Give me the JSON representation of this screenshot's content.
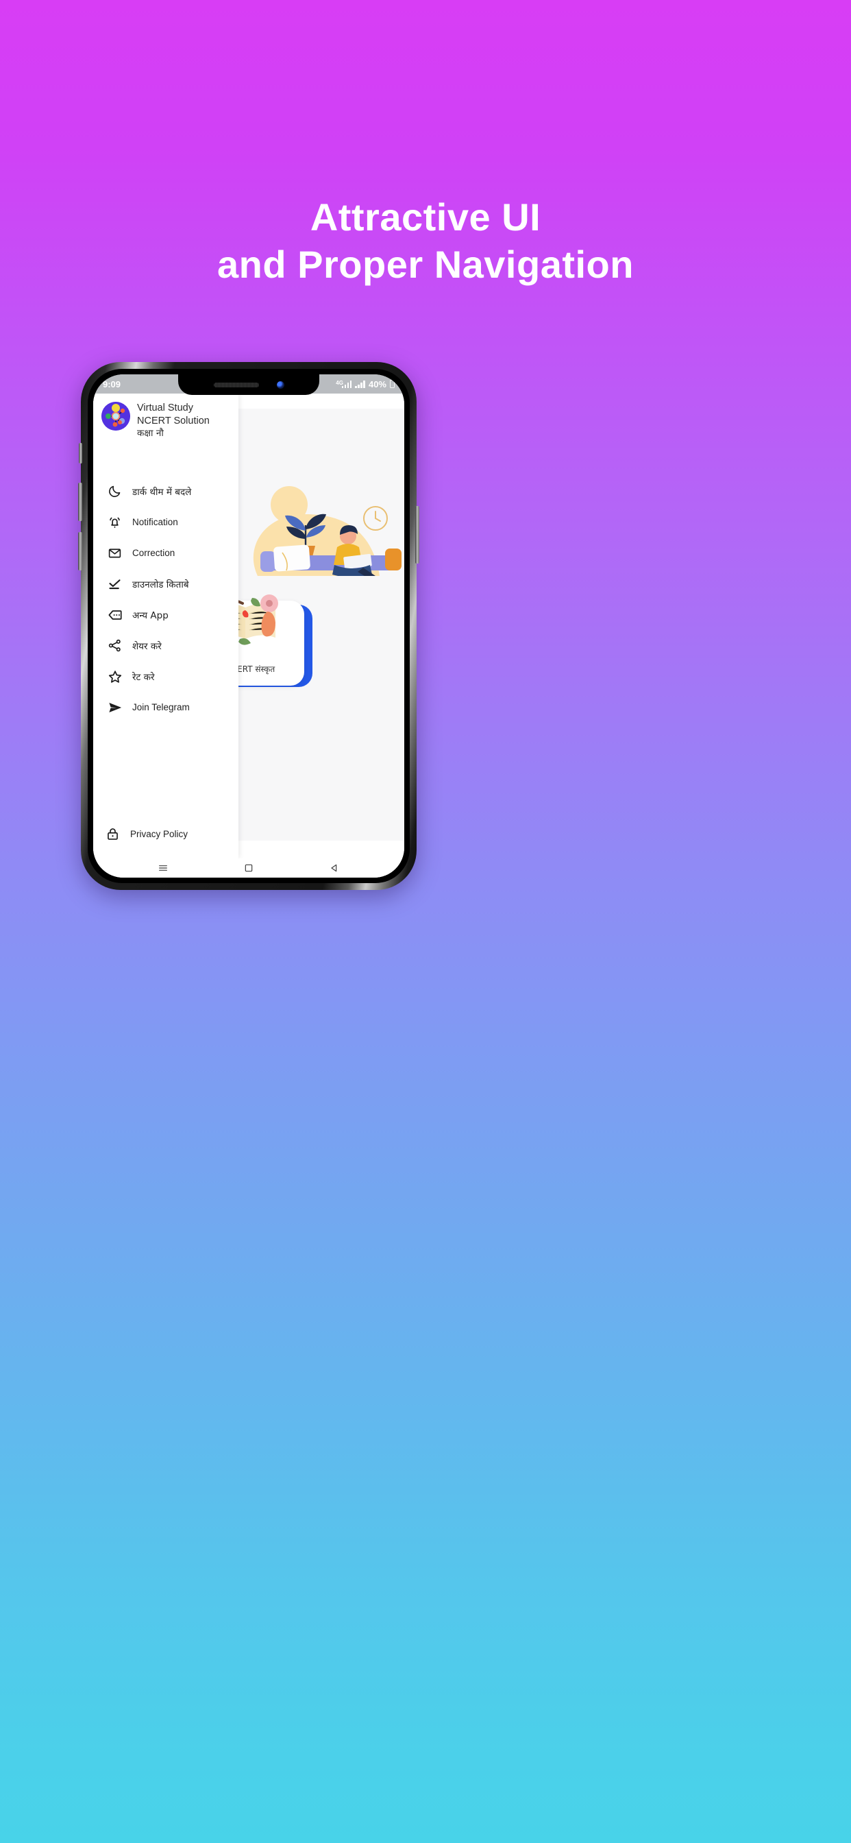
{
  "promo": {
    "headline_line1": "Attractive UI",
    "headline_line2": "and Proper Navigation",
    "gradient_top": "#d83df5",
    "gradient_bottom": "#48d3e9",
    "headline_color": "#ffffff"
  },
  "status_bar": {
    "time": "9:09",
    "network_label": "4G",
    "battery_percent": "40%"
  },
  "drawer": {
    "app_title_line1": "Virtual Study",
    "app_title_line2": "NCERT Solution",
    "app_title_line3": "कक्षा नौ",
    "logo_icon": "molecule-icon",
    "items": [
      {
        "label": "डार्क थीम में बदले",
        "icon": "moon-icon",
        "name": "dark-theme"
      },
      {
        "label": "Notification",
        "icon": "bell-icon",
        "name": "notification"
      },
      {
        "label": "Correction",
        "icon": "envelope-icon",
        "name": "correction"
      },
      {
        "label": "डाउनलोड किताबे",
        "icon": "download-check-icon",
        "name": "download-books"
      },
      {
        "label": "अन्य App",
        "icon": "more-tag-icon",
        "name": "other-apps"
      },
      {
        "label": "शेयर करे",
        "icon": "share-icon",
        "name": "share"
      },
      {
        "label": "रेट करे",
        "icon": "star-icon",
        "name": "rate"
      },
      {
        "label": "Join Telegram",
        "icon": "send-icon",
        "name": "join-telegram"
      }
    ],
    "footer": {
      "label": "Privacy Policy",
      "icon": "lock-icon"
    }
  },
  "content": {
    "menu_button_icon": "hamburger-icon",
    "illustration": "person-studying-on-sofa",
    "card": {
      "title": "NCERT संस्कृत",
      "art": "open-book-with-flowers",
      "accent_color": "#2458e6"
    }
  },
  "navigation_bar": {
    "recents_icon": "recents-icon",
    "home_icon": "home-square-icon",
    "back_icon": "back-triangle-icon"
  }
}
